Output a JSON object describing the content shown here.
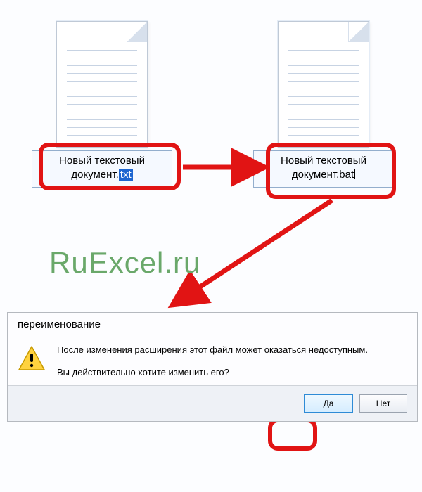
{
  "files": {
    "left": {
      "prefix": "Новый текстовый документ.",
      "selected_ext": "txt"
    },
    "right": {
      "full": "Новый текстовый документ.bat"
    }
  },
  "brand": "RuExcel.ru",
  "dialog": {
    "title": "переименование",
    "line1": "После изменения расширения этот файл может оказаться недоступным.",
    "line2": "Вы действительно хотите изменить его?",
    "yes": "Да",
    "no": "Нет"
  }
}
